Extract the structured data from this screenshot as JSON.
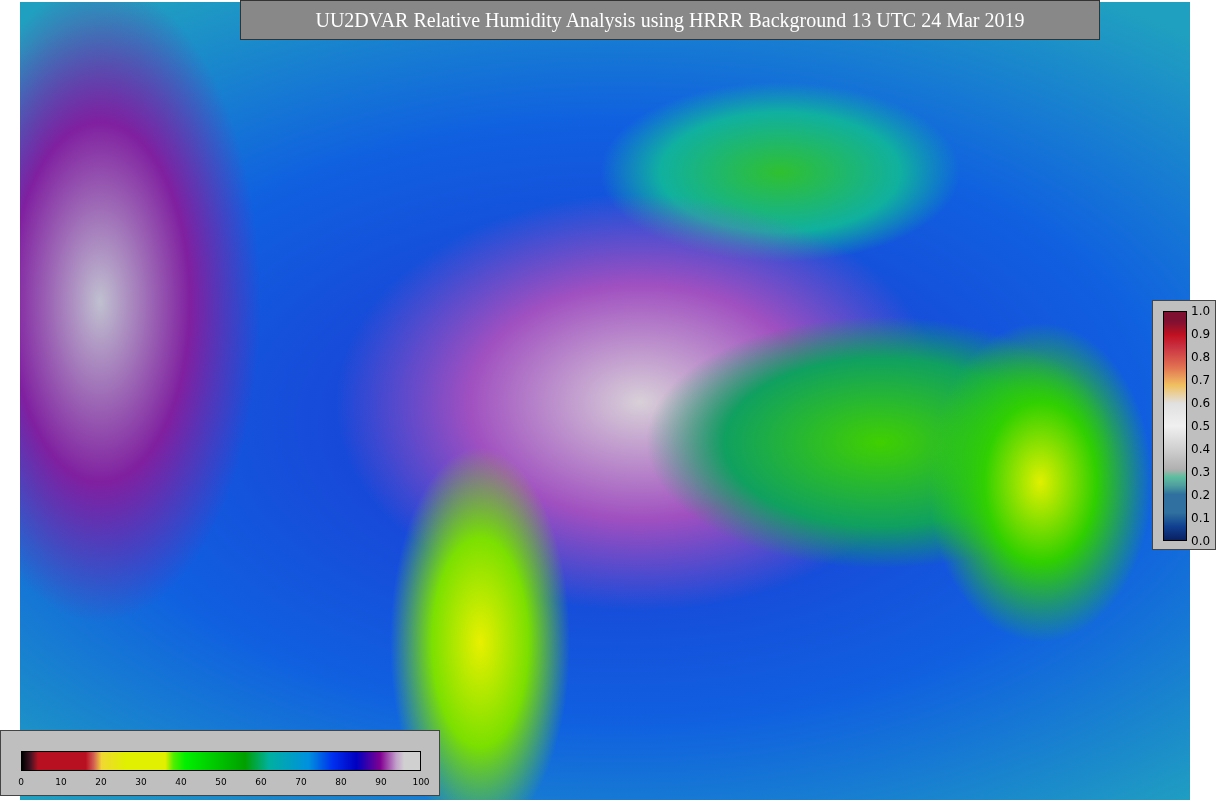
{
  "title": "UU2DVAR Relative Humidity Analysis using HRRR Background 13 UTC 24 Mar 2019",
  "humidity_colorbar": {
    "ticks": [
      "0",
      "10",
      "20",
      "30",
      "40",
      "50",
      "60",
      "70",
      "80",
      "90",
      "100"
    ]
  },
  "observation_colorbar": {
    "ticks": [
      "1.0",
      "0.9",
      "0.8",
      "0.7",
      "0.6",
      "0.5",
      "0.4",
      "0.3",
      "0.2",
      "0.1",
      "0.0"
    ]
  }
}
